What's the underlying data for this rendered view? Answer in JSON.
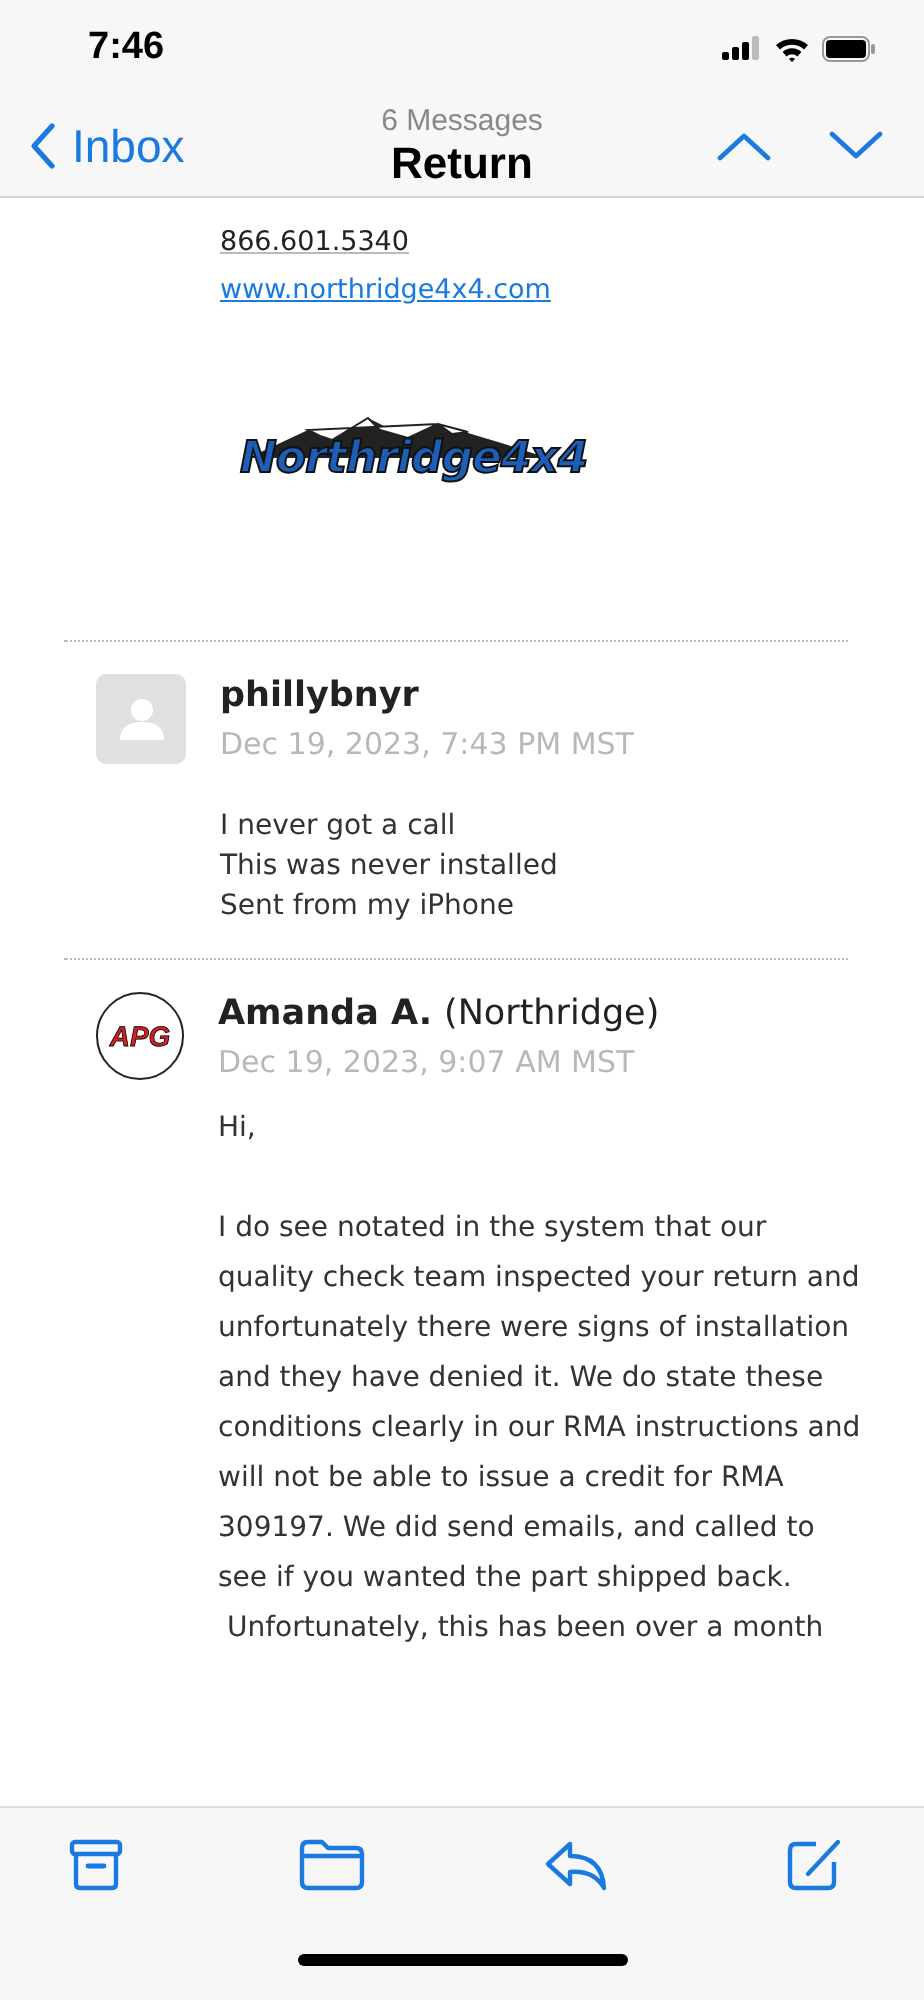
{
  "status_bar": {
    "time": "7:46"
  },
  "nav": {
    "back_label": "Inbox",
    "subtitle": "6 Messages",
    "title": "Return"
  },
  "signature": {
    "phone": "866.601.5340",
    "link": "www.northridge4x4.com",
    "logo_text": "Northridge4x4"
  },
  "messages": [
    {
      "avatar": {
        "kind": "placeholder"
      },
      "sender": "phillybnyr",
      "date": "Dec 19, 2023, 7:43 PM MST",
      "paragraphs": [
        {
          "lines": [
            "I never got a call",
            "This was never installed",
            "Sent from my iPhone"
          ]
        }
      ]
    },
    {
      "avatar": {
        "kind": "logo",
        "text": "APG"
      },
      "sender": "Amanda A.",
      "org": "(Northridge)",
      "date": "Dec 19, 2023, 9:07 AM MST",
      "paragraphs": [
        {
          "lines": [
            "Hi,"
          ]
        },
        {
          "lines": [
            "I do see notated in the system that our",
            "quality check team inspected your return and",
            "unfortunately there were signs of installation",
            "and they have denied it. We do state these",
            "conditions clearly in our RMA instructions and",
            "will not be able to issue a credit for RMA",
            "309197. We did send emails, and called to",
            "see if you wanted the part shipped back.",
            " Unfortunately, this has been over a month"
          ]
        }
      ]
    }
  ]
}
